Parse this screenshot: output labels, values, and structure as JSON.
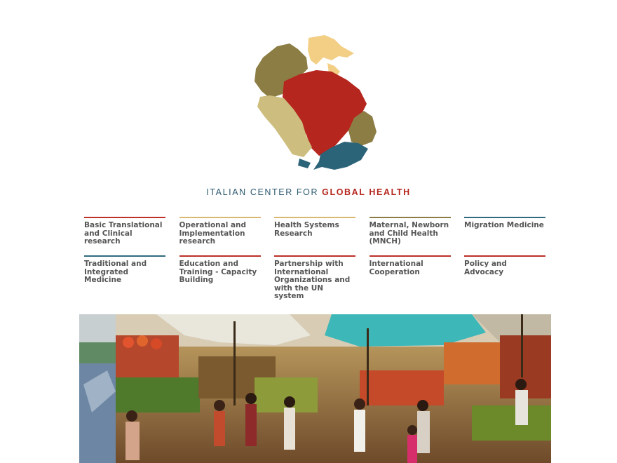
{
  "brand": {
    "part1": "ITALIAN CENTER FOR ",
    "part2": "GLOBAL HEALTH"
  },
  "topics": {
    "row1": [
      {
        "label": "Basic Translational and Clinical research",
        "accent": "#bd3128"
      },
      {
        "label": "Operational and Implementation research",
        "accent": "#d8b873"
      },
      {
        "label": "Health Systems Research",
        "accent": "#d8b873"
      },
      {
        "label": "Maternal, Newborn and Child Health (MNCH)",
        "accent": "#8c7d45"
      },
      {
        "label": "Migration Medicine",
        "accent": "#2f6b7e"
      }
    ],
    "row2": [
      {
        "label": "Traditional and Integrated Medicine",
        "accent": "#2f6b7e"
      },
      {
        "label": "Education and Training - Capacity Building",
        "accent": "#bd3128"
      },
      {
        "label": "Partnership with International Organizations and with the UN system",
        "accent": "#bd3128"
      },
      {
        "label": "International Cooperation",
        "accent": "#bd3128"
      },
      {
        "label": "Policy and Advocacy",
        "accent": "#bd3128"
      }
    ]
  },
  "colors": {
    "logo_red": "#b5261e",
    "logo_olive": "#8c7d45",
    "logo_sand": "#cdbd7e",
    "logo_light": "#f3cf86",
    "logo_teal": "#2b6379",
    "brand_blue": "#2e5a70"
  }
}
